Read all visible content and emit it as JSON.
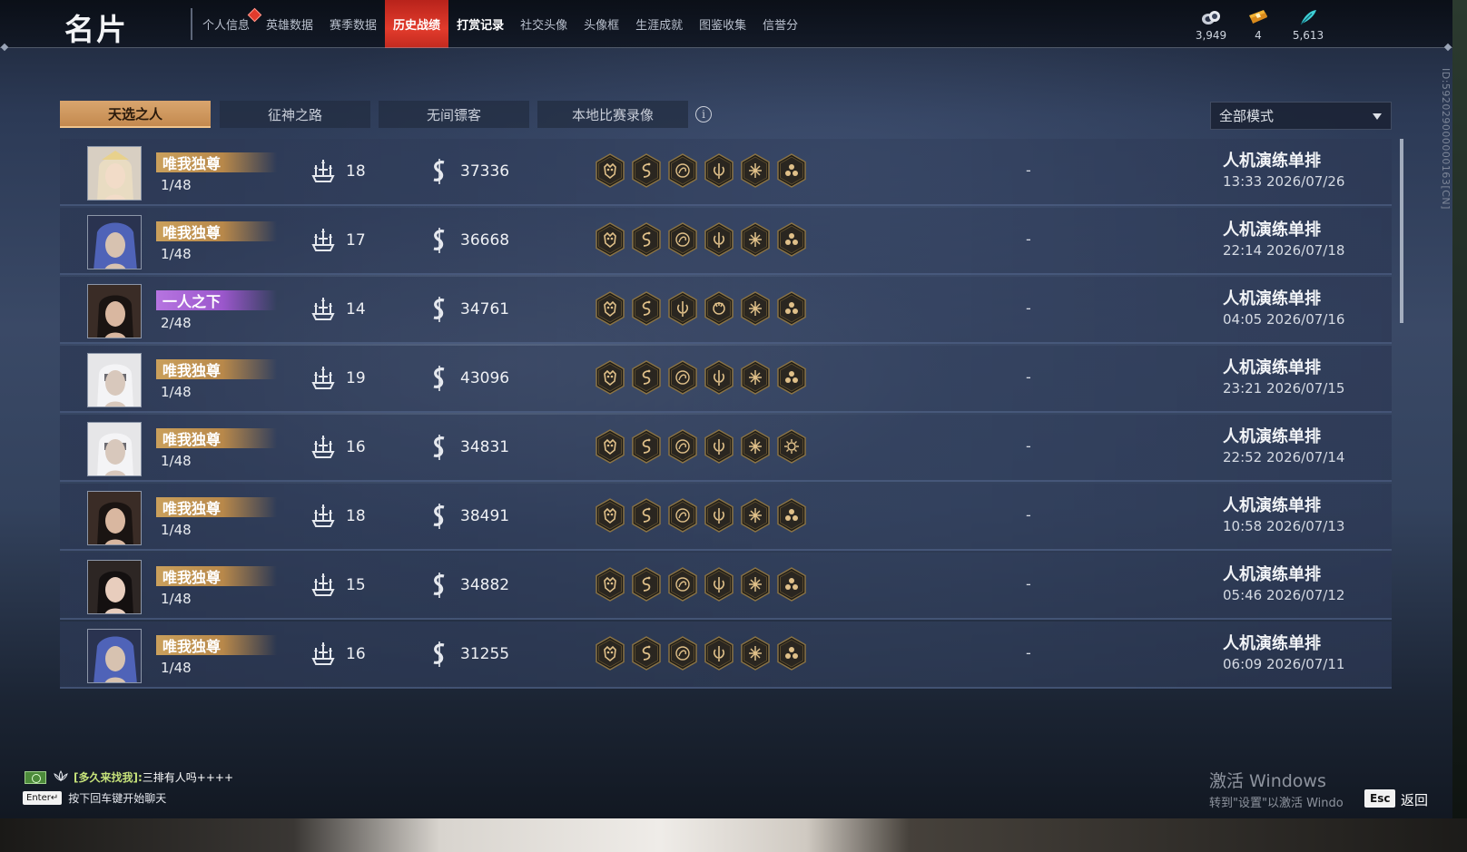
{
  "header": {
    "title": "名片",
    "nav": [
      {
        "label": "个人信息",
        "badge": true
      },
      {
        "label": "英雄数据"
      },
      {
        "label": "赛季数据"
      },
      {
        "label": "历史战绩",
        "active": true
      },
      {
        "label": "打赏记录",
        "bold": true
      },
      {
        "label": "社交头像"
      },
      {
        "label": "头像框"
      },
      {
        "label": "生涯成就"
      },
      {
        "label": "图鉴收集"
      },
      {
        "label": "信誉分"
      }
    ],
    "currencies": [
      {
        "icon": "coin-pile-icon",
        "value": "3,949"
      },
      {
        "icon": "ticket-icon",
        "value": "4"
      },
      {
        "icon": "feather-icon",
        "value": "5,613"
      }
    ]
  },
  "tabs": [
    {
      "label": "天选之人",
      "active": true
    },
    {
      "label": "征神之路"
    },
    {
      "label": "无间镖客"
    },
    {
      "label": "本地比赛录像"
    }
  ],
  "mode_select": {
    "value": "全部模式"
  },
  "side_id": "ID:592029000000163[CN]",
  "matches": [
    {
      "avatar": "blonde-crowned",
      "rank": "唯我独尊",
      "rank_color": "gold",
      "placement": "1/48",
      "kills": "18",
      "score": "37336",
      "result": "-",
      "mode": "人机演练单排",
      "time": "13:33 2026/07/26",
      "badges": [
        "demon-mask-icon",
        "serpent-coil-icon",
        "spiral-rune-icon",
        "sword-rune-icon",
        "cross-star-icon",
        "triple-flame-icon"
      ]
    },
    {
      "avatar": "blue-hood",
      "rank": "唯我独尊",
      "rank_color": "gold",
      "placement": "1/48",
      "kills": "17",
      "score": "36668",
      "result": "-",
      "mode": "人机演练单排",
      "time": "22:14 2026/07/18",
      "badges": [
        "demon-mask-icon",
        "serpent-coil-icon",
        "spiral-rune-icon",
        "sword-rune-icon",
        "cross-star-icon",
        "triple-flame-icon"
      ]
    },
    {
      "avatar": "dark-hair-male",
      "rank": "一人之下",
      "rank_color": "purple",
      "placement": "2/48",
      "kills": "14",
      "score": "34761",
      "result": "-",
      "mode": "人机演练单排",
      "time": "04:05 2026/07/16",
      "badges": [
        "demon-mask-icon",
        "serpent-coil-icon",
        "sword-rune-icon",
        "beast-claw-icon",
        "cross-star-icon",
        "triple-flame-icon"
      ]
    },
    {
      "avatar": "veiled-white",
      "rank": "唯我独尊",
      "rank_color": "gold",
      "placement": "1/48",
      "kills": "19",
      "score": "43096",
      "result": "-",
      "mode": "人机演练单排",
      "time": "23:21 2026/07/15",
      "badges": [
        "demon-mask-icon",
        "serpent-coil-icon",
        "spiral-rune-icon",
        "sword-rune-icon",
        "cross-star-icon",
        "triple-flame-icon"
      ]
    },
    {
      "avatar": "veiled-white",
      "rank": "唯我独尊",
      "rank_color": "gold",
      "placement": "1/48",
      "kills": "16",
      "score": "34831",
      "result": "-",
      "mode": "人机演练单排",
      "time": "22:52 2026/07/14",
      "badges": [
        "demon-mask-icon",
        "serpent-coil-icon",
        "spiral-rune-icon",
        "sword-rune-icon",
        "cross-star-icon",
        "gear-sun-icon"
      ]
    },
    {
      "avatar": "dark-hair-male",
      "rank": "唯我独尊",
      "rank_color": "gold",
      "placement": "1/48",
      "kills": "18",
      "score": "38491",
      "result": "-",
      "mode": "人机演练单排",
      "time": "10:58 2026/07/13",
      "badges": [
        "demon-mask-icon",
        "serpent-coil-icon",
        "spiral-rune-icon",
        "sword-rune-icon",
        "cross-star-icon",
        "triple-flame-icon"
      ]
    },
    {
      "avatar": "dark-hair-female",
      "rank": "唯我独尊",
      "rank_color": "gold",
      "placement": "1/48",
      "kills": "15",
      "score": "34882",
      "result": "-",
      "mode": "人机演练单排",
      "time": "05:46 2026/07/12",
      "badges": [
        "demon-mask-icon",
        "serpent-coil-icon",
        "spiral-rune-icon",
        "sword-rune-icon",
        "cross-star-icon",
        "triple-flame-icon"
      ]
    },
    {
      "avatar": "blue-hood",
      "rank": "唯我独尊",
      "rank_color": "gold",
      "placement": "1/48",
      "kills": "16",
      "score": "31255",
      "result": "-",
      "mode": "人机演练单排",
      "time": "06:09 2026/07/11",
      "badges": [
        "demon-mask-icon",
        "serpent-coil-icon",
        "spiral-rune-icon",
        "sword-rune-icon",
        "cross-star-icon",
        "triple-flame-icon"
      ]
    }
  ],
  "chat": {
    "name": "[多久来找我]:",
    "message": "三排有人吗++++",
    "enter_key": "Enter↵",
    "enter_hint": "按下回车键开始聊天"
  },
  "watermark": {
    "line1": "激活 Windows",
    "line2": "转到\"设置\"以激活 Windo"
  },
  "footer": {
    "esc_key": "Esc",
    "back_label": "返回"
  },
  "colors": {
    "accent_red": "#e23b2c",
    "gold_rank": "#caa05c",
    "purple_rank": "#b674e0",
    "tab_active": "#d9a56e"
  }
}
